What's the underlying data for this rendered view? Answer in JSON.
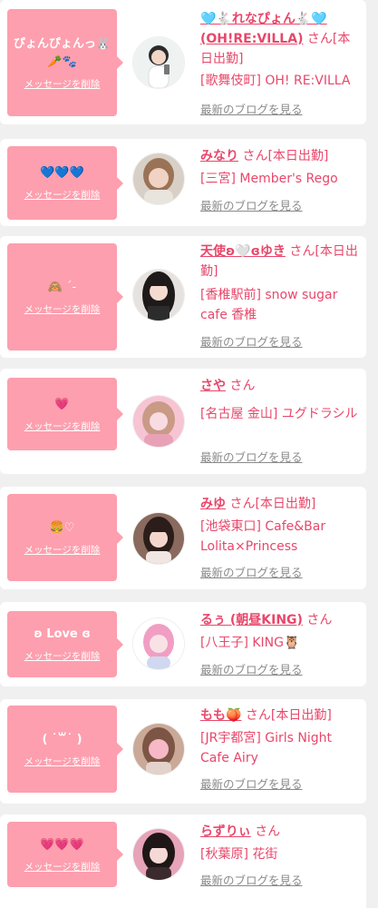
{
  "colors": {
    "accent": "#e8476a",
    "bubble": "#fd9fae",
    "card": "#ffffff",
    "page_bg": "#f0f0f0"
  },
  "delete_label": "メッセージを削除",
  "blog_label": "最新のブログを見る",
  "items": [
    {
      "message": "ぴょんぴょんっ🐰\n🥕🐾",
      "name": "🩵🐇れなぴょん🐇🩵(OH!RE:VILLA)",
      "suffix": "さん[本日出勤]",
      "shop": "[歌舞伎町] OH! RE:VILLA",
      "avatar": "girl in white outfit holding phone, light background"
    },
    {
      "message": "💙💙💙",
      "name": "みなり",
      "suffix": "さん[本日出勤]",
      "shop": "[三宮] Member's Rego",
      "avatar": "woman with light brown hair"
    },
    {
      "message": "🙈 ˊ-",
      "name": "天使ʚ🤍ɞゆき",
      "suffix": "さん[本日出勤]",
      "shop": "[香椎駅前] snow sugar cafe 香椎",
      "avatar": "girl with long black hair"
    },
    {
      "message": "💗",
      "name": "さや",
      "suffix": "さん",
      "shop": "[名古屋 金山] ユグドラシル",
      "avatar": "girl with pink tinted filter"
    },
    {
      "message": "🍔♡",
      "name": "みゆ",
      "suffix": "さん[本日出勤]",
      "shop": "[池袋東口] Cafe&Bar Lolita×Princess",
      "avatar": "girl with bangs and dark hair"
    },
    {
      "message": "ʚ Love ɞ",
      "name": "るぅ (朝昼KING)",
      "suffix": "さん",
      "shop": "[八王子] KING🦉",
      "avatar": "girl with pink hair, white background"
    },
    {
      "message": "( ˙꒳˙ )",
      "name": "もも🍑",
      "suffix": "さん[本日出勤]",
      "shop": "[JR宇都宮] Girls Night Cafe Airy",
      "avatar": "girl with pink blurred face"
    },
    {
      "message": "💗💗💗",
      "name": "らずりぃ",
      "suffix": "さん",
      "shop": "[秋葉原] 花街",
      "avatar": "girl in pink room with dark hair"
    }
  ]
}
